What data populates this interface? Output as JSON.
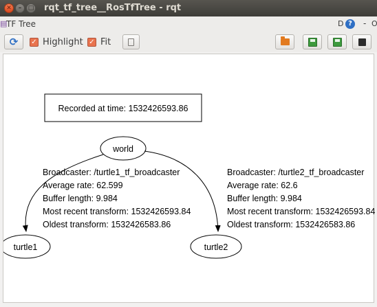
{
  "window": {
    "title": "rqt_tf_tree__RosTfTree - rqt",
    "close_glyph": "✕",
    "min_glyph": "–",
    "max_glyph": "□"
  },
  "plugin": {
    "title": "TF Tree",
    "dp_label": "D",
    "help_glyph": "?",
    "dash": "-",
    "o_label": "O"
  },
  "toolbar": {
    "refresh_glyph": "⟳",
    "highlight": {
      "label": "Highlight",
      "checked": true
    },
    "fit": {
      "label": "Fit",
      "checked": true
    },
    "check_glyph": "✓"
  },
  "graph": {
    "recorded_label": "Recorded at time: 1532426593.86",
    "nodes": {
      "world": "world",
      "turtle1": "turtle1",
      "turtle2": "turtle2"
    },
    "edge1": {
      "broadcaster": "Broadcaster: /turtle1_tf_broadcaster",
      "average_rate": "Average rate: 62.599",
      "buffer_length": "Buffer length: 9.984",
      "most_recent": "Most recent transform: 1532426593.84",
      "oldest": "Oldest transform: 1532426583.86"
    },
    "edge2": {
      "broadcaster": "Broadcaster: /turtle2_tf_broadcaster",
      "average_rate": "Average rate: 62.6",
      "buffer_length": "Buffer length: 9.984",
      "most_recent": "Most recent transform: 1532426593.84",
      "oldest": "Oldest transform: 1532426583.86"
    }
  },
  "colors": {
    "close_button": "#e0542a",
    "accent_orange": "#e9744f",
    "help_blue": "#2f6fc4"
  }
}
